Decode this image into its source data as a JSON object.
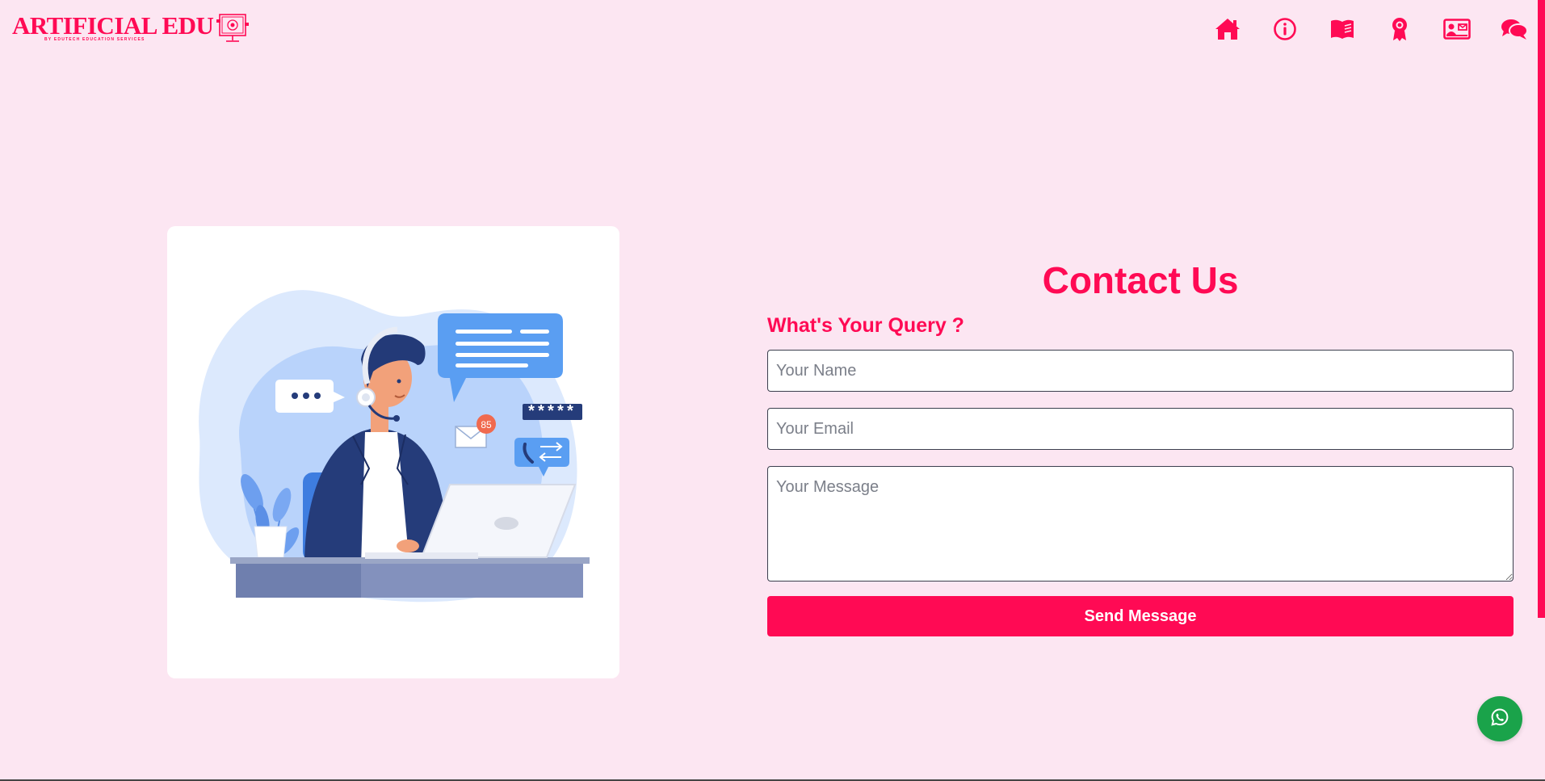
{
  "header": {
    "logo_title": "ARTIFICIAL EDU",
    "logo_subtitle": "BY EDUTECH EDUCATION SERVICES",
    "nav": [
      {
        "icon": "home-icon"
      },
      {
        "icon": "info-icon"
      },
      {
        "icon": "book-icon"
      },
      {
        "icon": "award-icon"
      },
      {
        "icon": "contact-card-icon"
      },
      {
        "icon": "chat-icon"
      }
    ]
  },
  "illustration": {
    "email_badge_count": "85",
    "password_text": "*****"
  },
  "contact": {
    "title": "Contact Us",
    "subtitle": "What's Your Query ?",
    "name_placeholder": "Your Name",
    "email_placeholder": "Your Email",
    "message_placeholder": "Your Message",
    "send_label": "Send Message"
  },
  "colors": {
    "accent": "#ff0a54",
    "background": "#fce6f2",
    "whatsapp": "#1aa34a"
  }
}
